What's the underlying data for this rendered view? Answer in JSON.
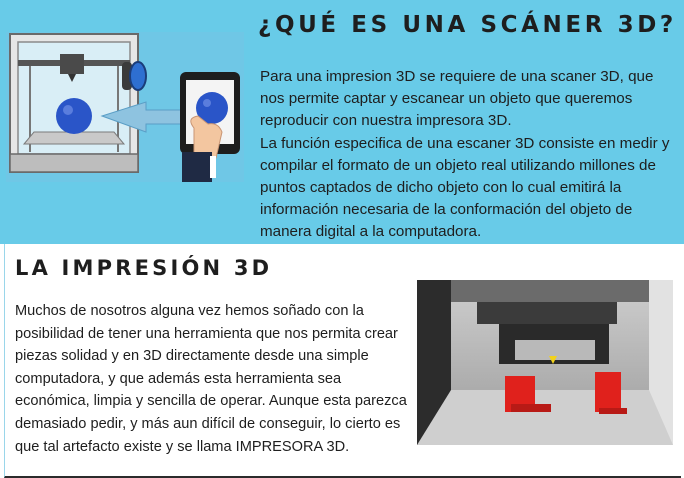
{
  "top_section": {
    "title": "¿QUÉ ES UNA SCÁNER 3D?",
    "paragraph_1": "Para una impresion 3D se requiere de una scaner 3D, que nos permite captar y escanear un objeto que queremos reproducir con nuestra impresora 3D.",
    "paragraph_2": "La función especifica de una escaner 3D consiste en medir y compilar el formato de un objeto real utilizando millones de puntos captados de dicho objeto con lo cual emitirá la información necesaria de la conformación del objeto de manera digital a la computadora."
  },
  "bottom_section": {
    "title": "LA IMPRESIÓN 3D",
    "paragraph": "Muchos de nosotros alguna vez hemos soñado con la posibilidad de tener una herramienta que nos permita crear piezas solidad y en 3D directamente desde una simple computadora, y que además esta herramienta sea económica, limpia y sencilla de operar. Aunque esta parezca demasiado pedir, y más aun difícil de conseguir, lo cierto es que tal artefacto existe y se llama IMPRESORA 3D."
  },
  "colors": {
    "band_background": "#68cbe8",
    "text": "#1e1e1e",
    "sphere_blue": "#2a55c8",
    "print_red": "#e0211c"
  },
  "images": {
    "scanner_illustration": "3d-printer-and-tablet-illustration",
    "printer_photo": "3d-printer-printing-red-parts-photo"
  }
}
